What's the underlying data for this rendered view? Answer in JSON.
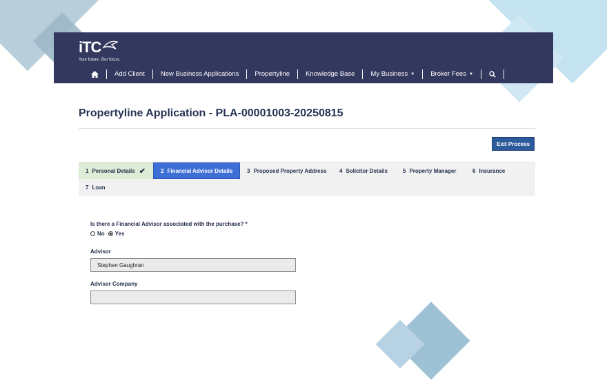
{
  "logo": {
    "text": "iTC",
    "tagline": "Your future. Our focus."
  },
  "nav": {
    "items": [
      {
        "label": "Add Client"
      },
      {
        "label": "New Business Applications"
      },
      {
        "label": "Propertyline"
      },
      {
        "label": "Knowledge Base"
      },
      {
        "label": "My Business",
        "caret": "▼"
      },
      {
        "label": "Broker Fees",
        "caret": "▼"
      }
    ]
  },
  "page": {
    "title": "Propertyline Application - PLA-00001003-20250815",
    "exit_label": "Exit Process"
  },
  "steps": [
    {
      "num": "1",
      "label": "Personal Details",
      "state": "done",
      "check": "✔"
    },
    {
      "num": "2",
      "label": "Financial Advisor Details",
      "state": "active"
    },
    {
      "num": "3",
      "label": "Proposed Property Address"
    },
    {
      "num": "4",
      "label": "Solicitor Details"
    },
    {
      "num": "5",
      "label": "Property Manager"
    },
    {
      "num": "6",
      "label": "Insurance"
    },
    {
      "num": "7",
      "label": "Loan"
    }
  ],
  "form": {
    "question": "Is there a Financial Advisor associated with the purchase? *",
    "options": [
      {
        "label": "No",
        "checked": false
      },
      {
        "label": "Yes",
        "checked": true
      }
    ],
    "advisor_label": "Advisor",
    "advisor_value": "Stephen Gaughran",
    "company_label": "Advisor Company",
    "company_value": ""
  },
  "colors": {
    "header_bg": "#33385e",
    "active_step": "#3d6fd6",
    "done_step": "#dcecd6",
    "exit_button": "#2d5a9a"
  }
}
